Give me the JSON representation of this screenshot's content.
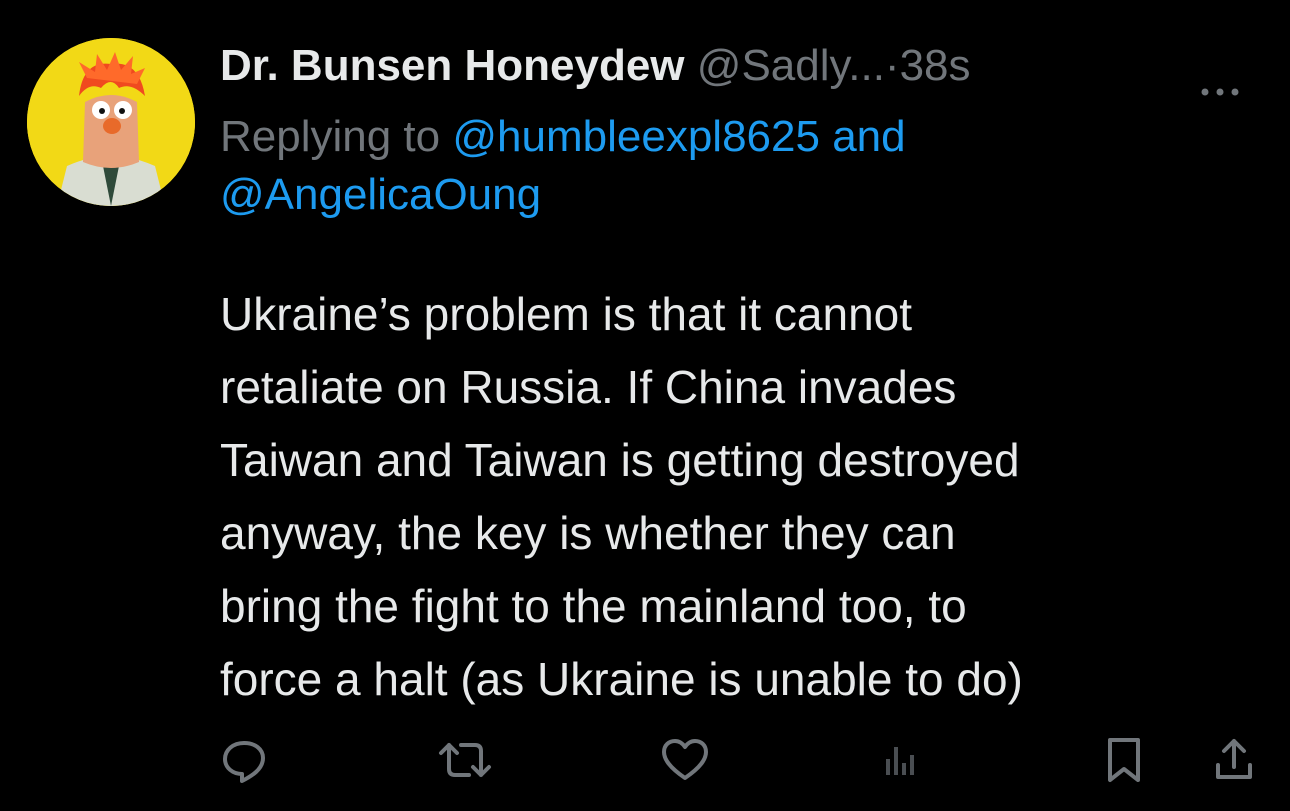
{
  "tweet": {
    "author_name": "Dr. Bunsen Honeydew",
    "author_handle": "@Sadly...",
    "separator": "·",
    "time": "38s",
    "more_label": "···",
    "reply_prefix": "Replying to",
    "reply_mention_1": "@humbleexpl8625",
    "reply_conjunction": "and",
    "reply_mention_2": "@AngelicaOung",
    "body_lines": [
      "Ukraine’s problem is that it cannot",
      "retaliate on Russia. If China invades",
      "Taiwan and Taiwan is getting destroyed",
      "anyway, the key is whether they can",
      "bring the fight to the mainland too, to",
      "force a halt (as Ukraine is unable to do)"
    ]
  },
  "actions": {
    "reply_icon": "reply-icon",
    "retweet_icon": "retweet-icon",
    "like_icon": "heart-icon",
    "views_icon": "views-chart-icon",
    "bookmark_icon": "bookmark-icon",
    "share_icon": "share-upload-icon"
  },
  "colors": {
    "background": "#000000",
    "text": "#e7e9ea",
    "muted": "#71767b",
    "link": "#1d9bf0",
    "avatar_bg": "#f2d916"
  }
}
